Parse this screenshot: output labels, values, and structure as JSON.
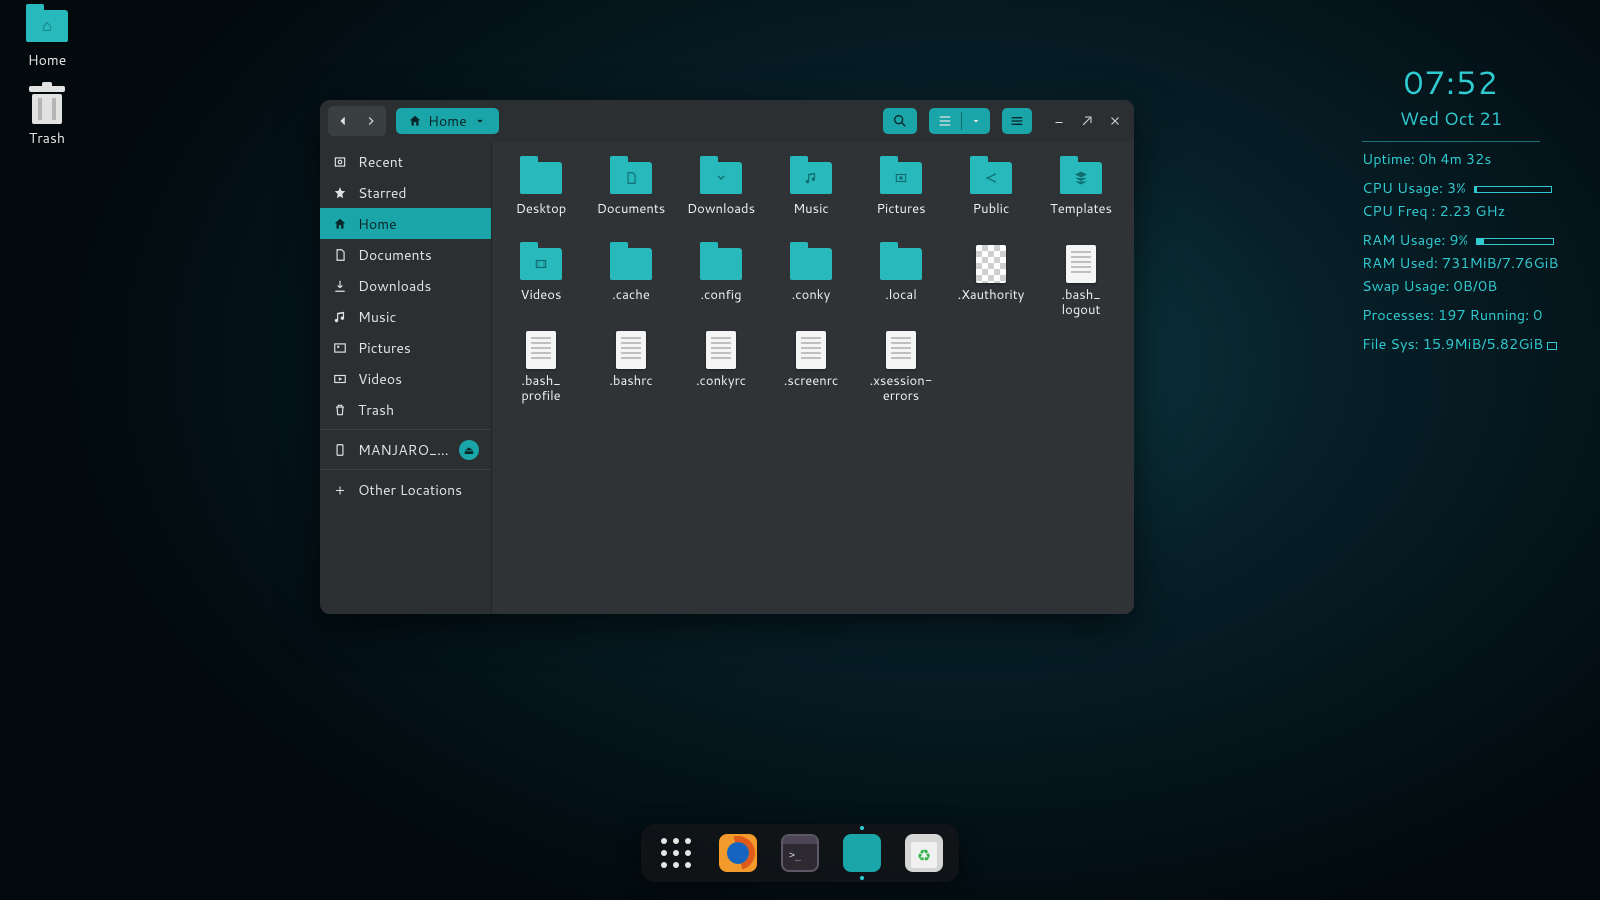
{
  "desktop": {
    "home_label": "Home",
    "trash_label": "Trash"
  },
  "filemanager": {
    "path_label": "Home",
    "sidebar": [
      {
        "icon": "recent",
        "label": "Recent"
      },
      {
        "icon": "star",
        "label": "Starred"
      },
      {
        "icon": "home",
        "label": "Home",
        "active": true
      },
      {
        "icon": "doc",
        "label": "Documents"
      },
      {
        "icon": "download",
        "label": "Downloads"
      },
      {
        "icon": "music",
        "label": "Music"
      },
      {
        "icon": "picture",
        "label": "Pictures"
      },
      {
        "icon": "video",
        "label": "Videos"
      },
      {
        "icon": "trash",
        "label": "Trash"
      }
    ],
    "mount": {
      "label": "MANJARO_GN…"
    },
    "other_locations": "Other Locations",
    "items": [
      {
        "type": "folder",
        "glyph": "",
        "name": "Desktop"
      },
      {
        "type": "folder",
        "glyph": "doc",
        "name": "Documents"
      },
      {
        "type": "folder",
        "glyph": "down",
        "name": "Downloads"
      },
      {
        "type": "folder",
        "glyph": "music",
        "name": "Music"
      },
      {
        "type": "folder",
        "glyph": "pic",
        "name": "Pictures"
      },
      {
        "type": "folder",
        "glyph": "share",
        "name": "Public"
      },
      {
        "type": "folder",
        "glyph": "tpl",
        "name": "Templates"
      },
      {
        "type": "folder",
        "glyph": "video",
        "name": "Videos"
      },
      {
        "type": "folder",
        "glyph": "",
        "name": ".cache"
      },
      {
        "type": "folder",
        "glyph": "",
        "name": ".config"
      },
      {
        "type": "folder",
        "glyph": "",
        "name": ".conky"
      },
      {
        "type": "folder",
        "glyph": "",
        "name": ".local"
      },
      {
        "type": "checker",
        "name": ".Xauthority"
      },
      {
        "type": "doc",
        "name": ".bash_\nlogout"
      },
      {
        "type": "doc",
        "name": ".bash_\nprofile"
      },
      {
        "type": "doc",
        "name": ".bashrc"
      },
      {
        "type": "doc",
        "name": ".conkyrc"
      },
      {
        "type": "doc",
        "name": ".screenrc"
      },
      {
        "type": "doc",
        "name": ".xsession-\nerrors"
      }
    ]
  },
  "conky": {
    "time": "07:52",
    "date": "Wed Oct 21",
    "uptime": "Uptime: 0h 4m 32s",
    "cpu_usage_label": "CPU Usage: 3%",
    "cpu_usage_pct": 3,
    "cpu_freq": "CPU Freq : 2.23 GHz",
    "ram_usage_label": "RAM Usage: 9%",
    "ram_usage_pct": 9,
    "ram_used": "RAM Used: 731MiB/7.76GiB",
    "swap": "Swap Usage: 0B/0B",
    "procs": "Processes: 197   Running: 0",
    "fs": "File Sys: 15.9MiB/5.82GiB"
  },
  "dock": {
    "items": [
      "apps",
      "firefox",
      "terminal",
      "files",
      "recycle"
    ]
  }
}
